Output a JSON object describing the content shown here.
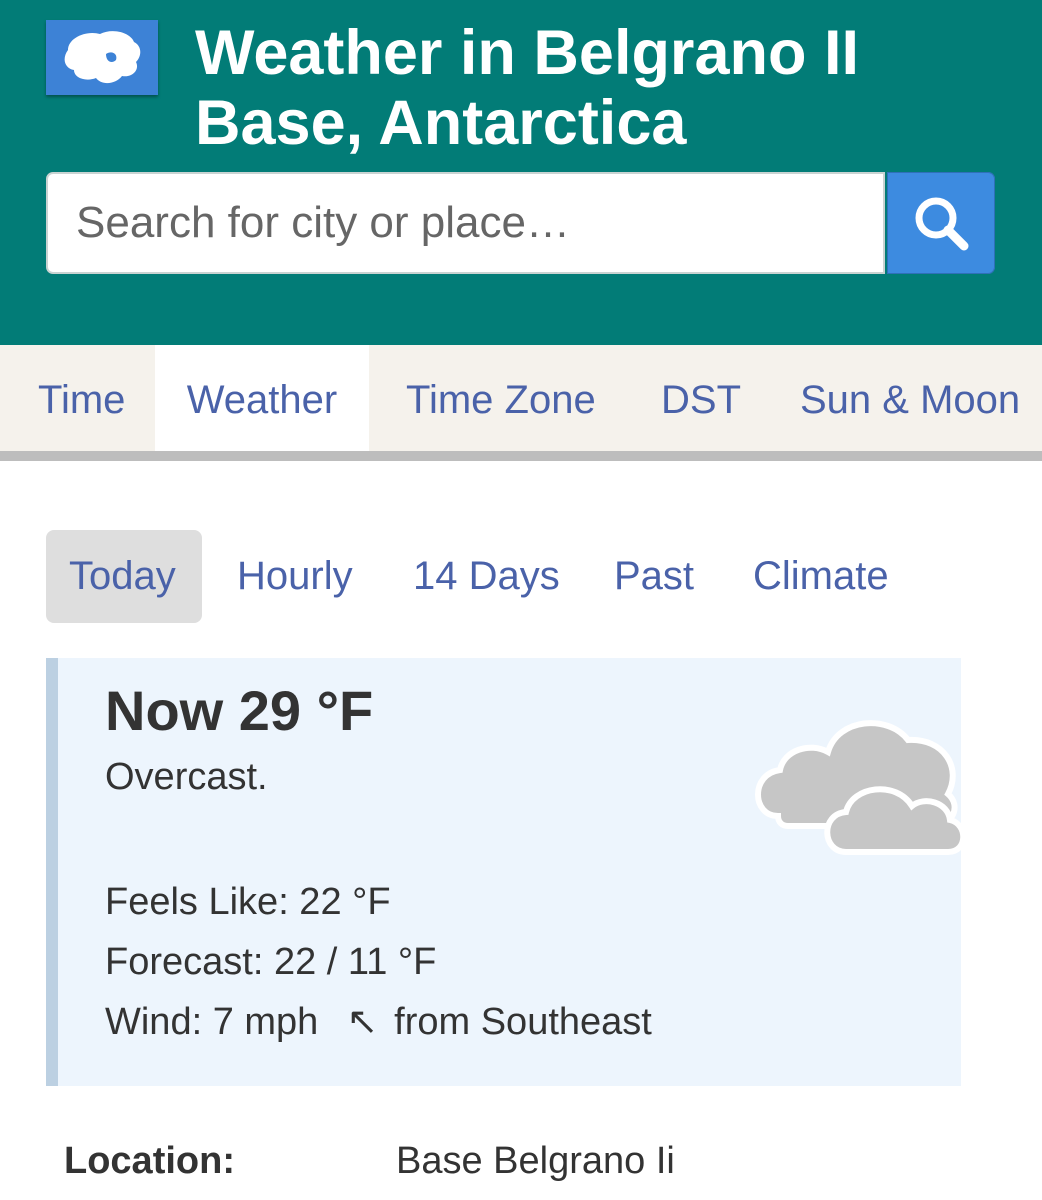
{
  "header": {
    "title": "Weather in Belgrano II Base, Antarctica",
    "flag_icon": "antarctica-flag",
    "background_color": "#027c77"
  },
  "search": {
    "placeholder": "Search for city or place…",
    "button_icon": "search-icon",
    "button_color": "#3d8be0"
  },
  "main_nav": {
    "tabs": [
      {
        "label": "Time",
        "active": false
      },
      {
        "label": "Weather",
        "active": true
      },
      {
        "label": "Time Zone",
        "active": false
      },
      {
        "label": "DST",
        "active": false
      },
      {
        "label": "Sun & Moon",
        "active": false
      }
    ]
  },
  "sub_nav": {
    "tabs": [
      {
        "label": "Today",
        "active": true
      },
      {
        "label": "Hourly",
        "active": false
      },
      {
        "label": "14 Days",
        "active": false
      },
      {
        "label": "Past",
        "active": false
      },
      {
        "label": "Climate",
        "active": false
      }
    ]
  },
  "weather": {
    "now": "Now 29 °F",
    "description": "Overcast.",
    "feels_like": "Feels Like: 22 °F",
    "forecast": "Forecast: 22 / 11 °F",
    "wind_label": "Wind: 7 mph",
    "wind_arrow": "↖",
    "wind_direction": "from Southeast",
    "condition_icon": "overcast-cloud-icon"
  },
  "location": {
    "label": "Location:",
    "value": "Base Belgrano Ii"
  }
}
